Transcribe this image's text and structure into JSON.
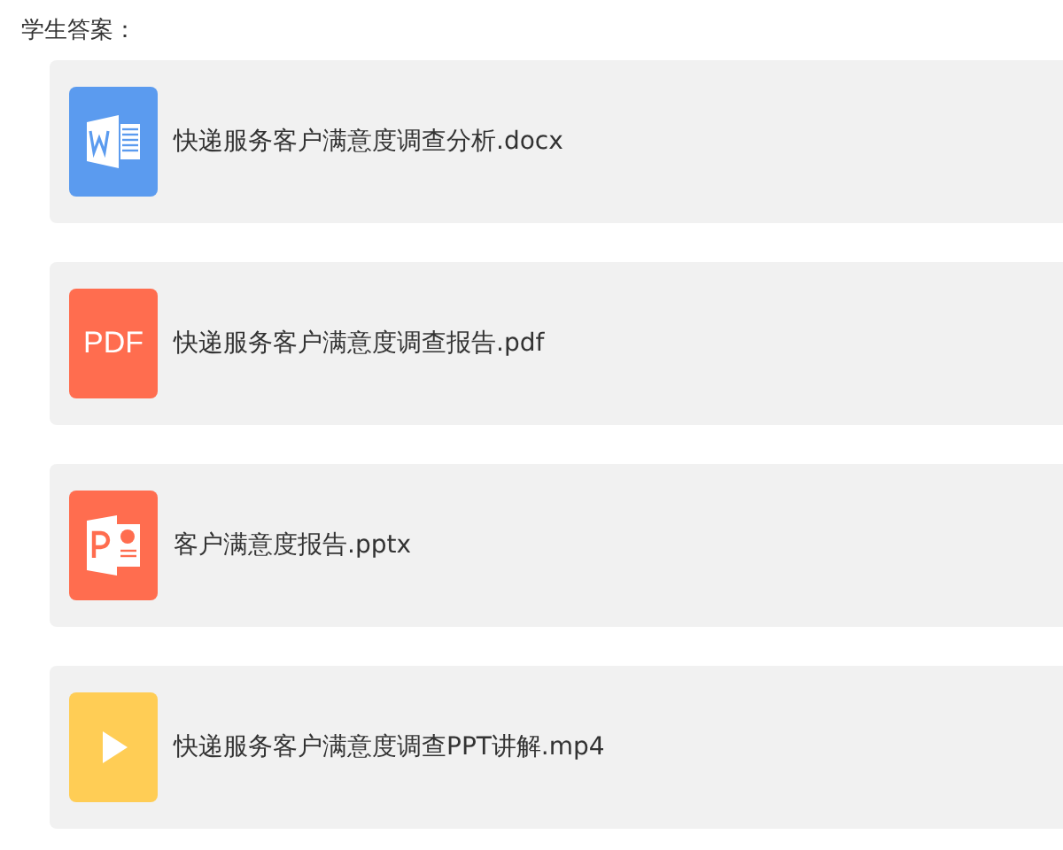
{
  "label": "学生答案：",
  "files": [
    {
      "kind": "word",
      "name": "快递服务客户满意度调查分析.docx"
    },
    {
      "kind": "pdf",
      "badge": "PDF",
      "name": "快递服务客户满意度调查报告.pdf"
    },
    {
      "kind": "ppt",
      "name": "客户满意度报告.pptx"
    },
    {
      "kind": "video",
      "name": "快递服务客户满意度调查PPT讲解.mp4"
    }
  ]
}
